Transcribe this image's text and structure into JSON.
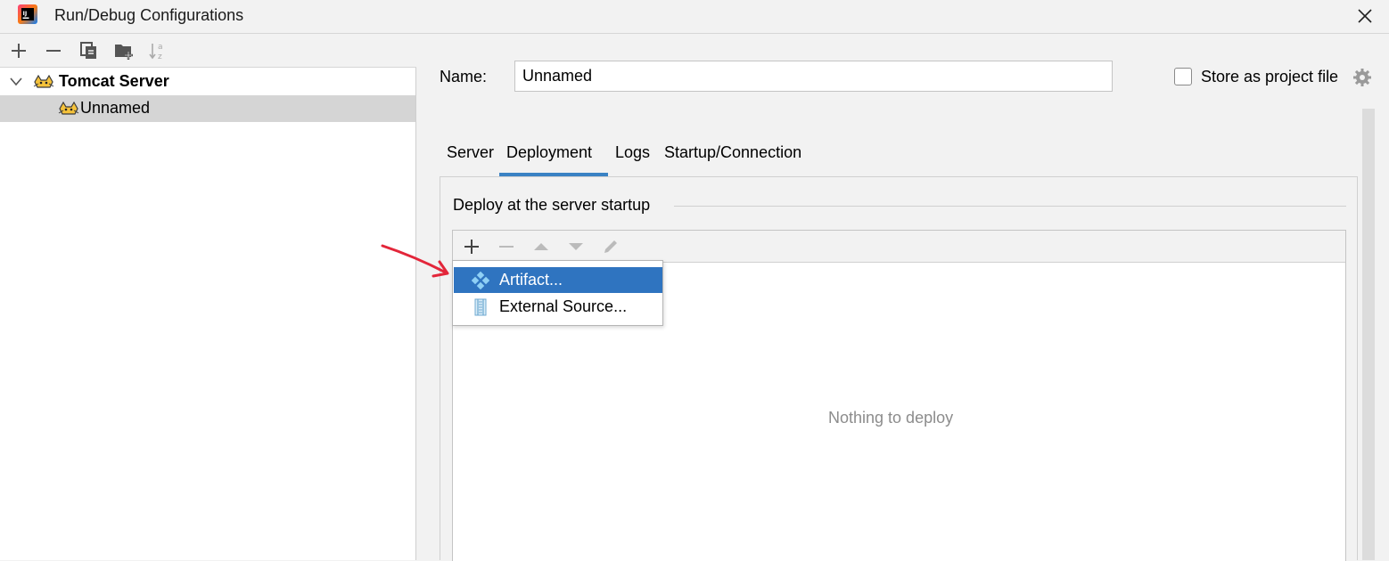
{
  "window": {
    "title": "Run/Debug Configurations"
  },
  "tree": {
    "group_label": "Tomcat Server",
    "item_label": "Unnamed"
  },
  "config": {
    "name_label": "Name:",
    "name_value": "Unnamed",
    "store_label": "Store as project file",
    "store_checked": false
  },
  "tabs": [
    {
      "label": "Server"
    },
    {
      "label": "Deployment",
      "active": true
    },
    {
      "label": "Logs"
    },
    {
      "label": "Startup/Connection"
    }
  ],
  "deployment": {
    "section_title": "Deploy at the server startup",
    "empty_text": "Nothing to deploy"
  },
  "popup_menu": [
    {
      "label": "Artifact...",
      "icon": "artifact-icon",
      "selected": true
    },
    {
      "label": "External Source...",
      "icon": "external-source-icon",
      "selected": false
    }
  ],
  "colors": {
    "accent": "#3a82c4",
    "menu_highlight": "#2f74c0",
    "annotation_arrow": "#e3263a"
  }
}
